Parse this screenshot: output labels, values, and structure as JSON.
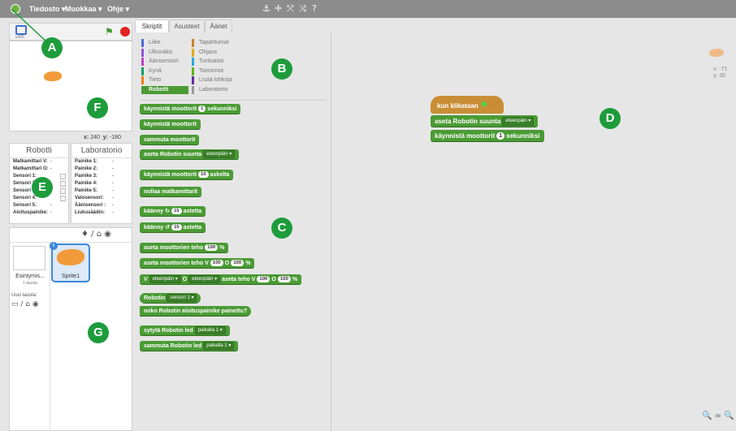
{
  "menu": {
    "file": "Tiedosto ▾",
    "edit": "Muokkaa ▾",
    "help": "Ohje ▾",
    "tools": [
      "⚓",
      "✛",
      "⤧",
      "⤨",
      "?"
    ]
  },
  "stage": {
    "version": "v426",
    "x_label": "x:",
    "x_value": "240",
    "y_label": "y:",
    "y_value": "-180"
  },
  "robot_panel": {
    "title": "Robotti",
    "rows": [
      {
        "label": "Matkamittari V:",
        "value": "-"
      },
      {
        "label": "Matkamittari O:",
        "value": "-"
      },
      {
        "label": "Sensori 1:",
        "value": ""
      },
      {
        "label": "Sensori 2:",
        "value": ""
      },
      {
        "label": "Sensori 3:",
        "value": ""
      },
      {
        "label": "Sensori 4:",
        "value": ""
      },
      {
        "label": "Sensori 5:",
        "value": "-"
      },
      {
        "label": "Aloituspainike:",
        "value": "-"
      }
    ]
  },
  "lab_panel": {
    "title": "Laboratorio",
    "rows": [
      {
        "label": "Painike 1:",
        "value": "-"
      },
      {
        "label": "Painike 2:",
        "value": "-"
      },
      {
        "label": "Painike 3:",
        "value": "-"
      },
      {
        "label": "Painike 4:",
        "value": "-"
      },
      {
        "label": "Painike 5:",
        "value": "-"
      },
      {
        "label": "Valosensori:",
        "value": "-"
      },
      {
        "label": "Äänisensori :",
        "value": "-"
      },
      {
        "label": "Liukusäädin:",
        "value": "-"
      }
    ]
  },
  "sprites": {
    "stage_label": "Esintymis...",
    "backdrop_count": "1 tausta",
    "new_backdrop": "Uusi tausta:",
    "new_backdrop_icons": "▭ / ⌂ ◉",
    "toolbar_icons": "♦ / ⌂ ◉",
    "sprite_name": "Sprite1",
    "info": "i"
  },
  "tabs": [
    "Skriptit",
    "Asusteet",
    "Äänet"
  ],
  "categories_left": [
    {
      "label": "Liike",
      "color": "#4a6cd4"
    },
    {
      "label": "Ulkonäkö",
      "color": "#8a55d7"
    },
    {
      "label": "Äänisensori",
      "color": "#bb42c3"
    },
    {
      "label": "Kynä",
      "color": "#0e9a6c"
    },
    {
      "label": "Tieto",
      "color": "#ee7d16"
    },
    {
      "label": "Robotti",
      "color": "#4b9b35"
    }
  ],
  "categories_right": [
    {
      "label": "Tapahtumat",
      "color": "#c88330"
    },
    {
      "label": "Ohjaus",
      "color": "#e1a91a"
    },
    {
      "label": "Tuntoaisti",
      "color": "#2ca5e2"
    },
    {
      "label": "Toiminnot",
      "color": "#5cb712"
    },
    {
      "label": "Lisää lohkoja",
      "color": "#632d99"
    },
    {
      "label": "Laboratorio",
      "color": "#999999"
    }
  ],
  "palette_blocks": {
    "b1_a": "käynnistä moottorit",
    "b1_n": "1",
    "b1_b": "sekunniksi",
    "b2": "käynnistä moottorit",
    "b3": "sammuta moottorit",
    "b4_a": "aseta Robotin suunta",
    "b4_d": "eteenpäin ▾",
    "b5_a": "käynnistä moottorit",
    "b5_n": "10",
    "b5_b": "askelta",
    "b6": "nollaa matkamittarit",
    "b7_a": "käänny ↻",
    "b7_n": "15",
    "b7_b": "astetta",
    "b8_a": "käänny ↺",
    "b8_n": "15",
    "b8_b": "astetta",
    "b9_a": "aseta moottorien teho",
    "b9_n": "100",
    "b9_b": "%",
    "b10_a": "aseta moottorien teho V",
    "b10_n1": "100",
    "b10_o": "O",
    "b10_n2": "100",
    "b10_b": "%",
    "b11_a": "V",
    "b11_d1": "eteenpäin ▾",
    "b11_o": "O",
    "b11_d2": "eteenpäin ▾",
    "b11_b": "aseta teho V",
    "b11_n1": "100",
    "b11_o2": "O",
    "b11_n2": "100",
    "b11_c": "%",
    "b12_a": "Robotin",
    "b12_d": "sensori 1 ▾",
    "b13": "onko Robotin aloituspainike painettu?",
    "b14_a": "sytytä Robotin led",
    "b14_d": "paikalla 1 ▾",
    "b15_a": "sammuta Robotin led",
    "b15_d": "paikalla 1 ▾"
  },
  "script": {
    "hat": "kun klikataan",
    "s1_a": "aseta Robotin suunta",
    "s1_d": "eteenpäin ▾",
    "s2_a": "käynnistä moottorit",
    "s2_n": "1",
    "s2_b": "sekunniksi",
    "sprite_x": "x: -71",
    "sprite_y": "y: 35",
    "zoom": "🔍 = 🔍"
  },
  "callouts": [
    "A",
    "B",
    "C",
    "D",
    "E",
    "F",
    "G"
  ]
}
